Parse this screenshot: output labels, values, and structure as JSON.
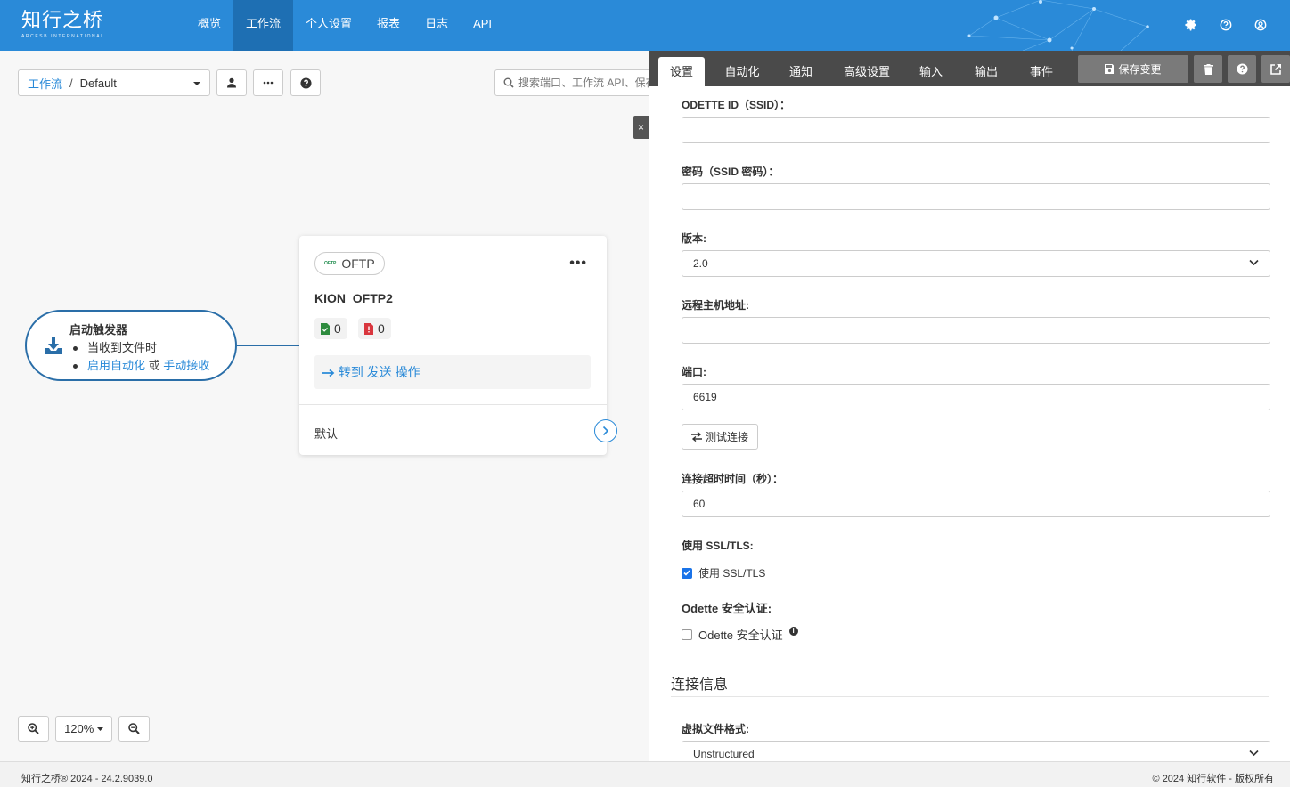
{
  "brand": {
    "name": "知行之桥",
    "subtitle": "ARCESB INTERNATIONAL"
  },
  "nav": [
    {
      "label": "概览"
    },
    {
      "label": "工作流",
      "active": true
    },
    {
      "label": "个人设置"
    },
    {
      "label": "报表"
    },
    {
      "label": "日志"
    },
    {
      "label": "API"
    }
  ],
  "top_icons": [
    "gear-icon",
    "help-icon",
    "user-icon"
  ],
  "breadcrumb": {
    "root": "工作流",
    "separator": "/",
    "current": "Default"
  },
  "search": {
    "placeholder": "搜索端口、工作流 API、保存"
  },
  "close_label": "×",
  "trigger": {
    "title": "启动触发器",
    "item1": "当收到文件时",
    "item2_a": "启用自动化",
    "item2_or": " 或 ",
    "item2_b": "手动接收"
  },
  "card": {
    "connector_icon_text": "OFTP",
    "connector_type": "OFTP",
    "name": "KION_OFTP2",
    "dots": "•••",
    "success_count": "0",
    "error_count": "0",
    "goto_label": "转到 发送 操作",
    "default_label": "默认"
  },
  "zoom": {
    "level": "120%"
  },
  "panel": {
    "tabs": [
      {
        "label": "设置",
        "active": true
      },
      {
        "label": "自动化"
      },
      {
        "label": "通知"
      },
      {
        "label": "高级设置"
      },
      {
        "label": "输入"
      },
      {
        "label": "输出"
      },
      {
        "label": "事件"
      }
    ],
    "save_label": "保存变更",
    "fields": {
      "odette_id_label": "ODETTE ID（SSID）：",
      "odette_id_value": "",
      "password_label": "密码（SSID 密码）：",
      "password_value": "",
      "version_label": "版本:",
      "version_value": "2.0",
      "remote_host_label": "远程主机地址:",
      "remote_host_value": "",
      "port_label": "端口:",
      "port_value": "6619",
      "test_button": "测试连接",
      "timeout_label": "连接超时时间（秒）：",
      "timeout_value": "60",
      "ssl_label": "使用 SSL/TLS:",
      "ssl_checkbox": "使用 SSL/TLS",
      "ssl_checked": true,
      "odette_auth_label": "Odette 安全认证:",
      "odette_auth_checkbox": "Odette 安全认证",
      "odette_auth_checked": false,
      "section_title": "连接信息",
      "vfile_label": "虚拟文件格式:",
      "vfile_value": "Unstructured"
    }
  },
  "footer": {
    "left": "知行之桥® 2024 - 24.2.9039.0",
    "right": "© 2024 知行软件 - 版权所有"
  },
  "colors": {
    "primary": "#2a8ad8",
    "nav_active": "#1e6fb3",
    "tabbar": "#4a4a4a",
    "trigger_border": "#2a6ea8"
  }
}
